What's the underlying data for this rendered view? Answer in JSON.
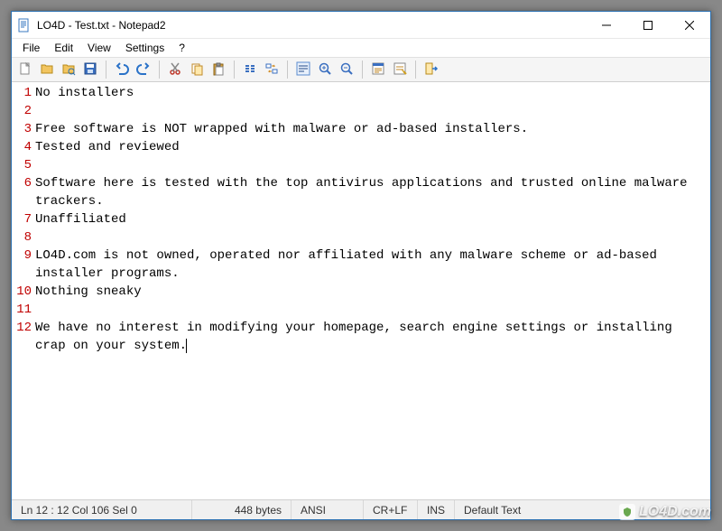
{
  "window": {
    "title": "LO4D - Test.txt - Notepad2"
  },
  "menu": {
    "file": "File",
    "edit": "Edit",
    "view": "View",
    "settings": "Settings",
    "help": "?"
  },
  "toolbar": {
    "icons": [
      "new-file-icon",
      "open-icon",
      "browse-icon",
      "save-icon",
      "sep",
      "undo-icon",
      "redo-icon",
      "sep",
      "cut-icon",
      "copy-icon",
      "paste-icon",
      "sep",
      "find-icon",
      "replace-icon",
      "sep",
      "word-wrap-icon",
      "zoom-in-icon",
      "zoom-out-icon",
      "sep",
      "scheme-icon",
      "customize-icon",
      "sep",
      "exit-icon"
    ]
  },
  "editor": {
    "lines": [
      {
        "n": 1,
        "text": "No installers"
      },
      {
        "n": 2,
        "text": ""
      },
      {
        "n": 3,
        "text": "Free software is NOT wrapped with malware or ad-based installers."
      },
      {
        "n": 4,
        "text": "Tested and reviewed"
      },
      {
        "n": 5,
        "text": ""
      },
      {
        "n": 6,
        "text": "Software here is tested with the top antivirus applications and trusted online malware trackers."
      },
      {
        "n": 7,
        "text": "Unaffiliated"
      },
      {
        "n": 8,
        "text": ""
      },
      {
        "n": 9,
        "text": "LO4D.com is not owned, operated nor affiliated with any malware scheme or ad-based installer programs."
      },
      {
        "n": 10,
        "text": "Nothing sneaky"
      },
      {
        "n": 11,
        "text": ""
      },
      {
        "n": 12,
        "text": "We have no interest in modifying your homepage, search engine settings or installing crap on your system."
      }
    ]
  },
  "status": {
    "position": "Ln 12 : 12   Col 106   Sel 0",
    "size": "448 bytes",
    "encoding": "ANSI",
    "eol": "CR+LF",
    "mode": "INS",
    "scheme": "Default Text"
  },
  "watermark": {
    "text": "LO4D.com"
  }
}
